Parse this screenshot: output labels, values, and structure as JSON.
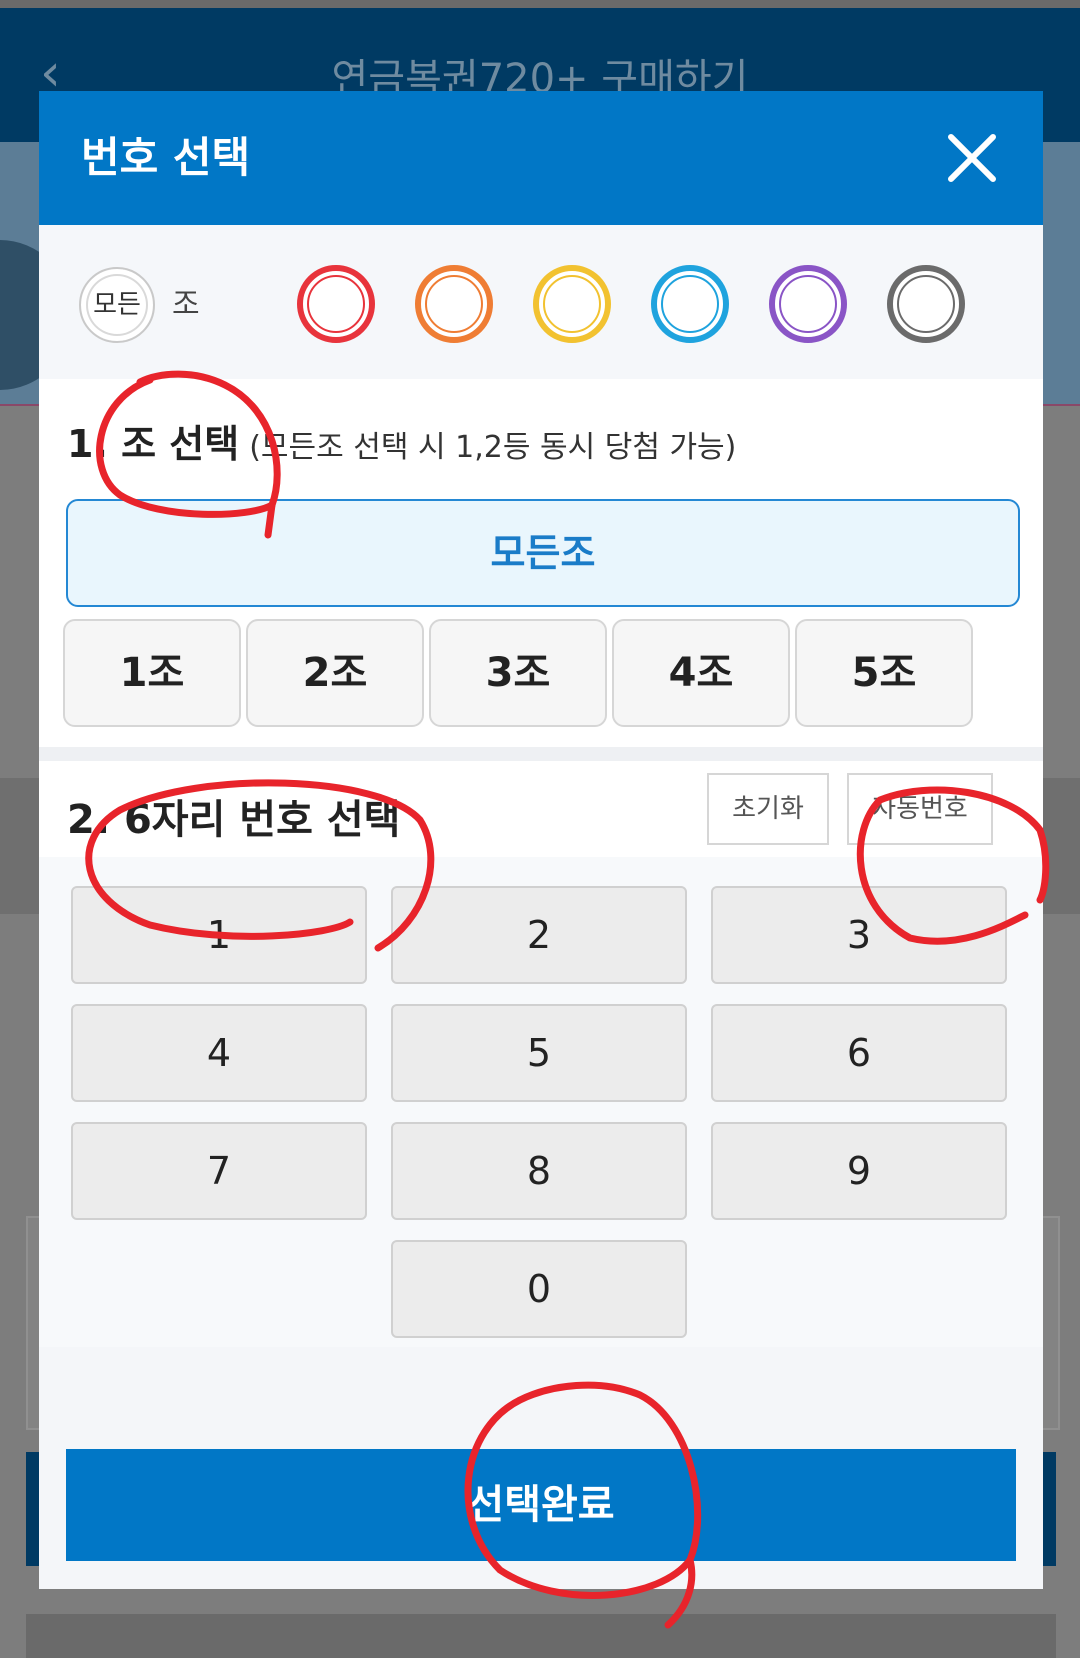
{
  "background": {
    "back_icon": "chevron-left",
    "page_title": "연금복권720+ 구매하기"
  },
  "modal": {
    "title": "번호 선택",
    "close_icon": "close-x",
    "group_selector": {
      "all_badge": "모든",
      "all_suffix": "조",
      "circle_colors": [
        "#e8343c",
        "#ef7d34",
        "#f2c230",
        "#1fa3de",
        "#8a55c6",
        "#6b6b6b"
      ]
    },
    "section1": {
      "title": "1. 조 선택",
      "subtitle": "(모든조 선택 시 1,2등 동시 당첨 가능)",
      "all_groups_button": "모든조",
      "group_buttons": [
        "1조",
        "2조",
        "3조",
        "4조",
        "5조"
      ]
    },
    "section2": {
      "title": "2. 6자리 번호 선택",
      "reset_button": "초기화",
      "auto_button": "자동번호",
      "keypad": [
        "1",
        "2",
        "3",
        "4",
        "5",
        "6",
        "7",
        "8",
        "9",
        "0"
      ]
    },
    "confirm_button": "선택완료"
  },
  "colors": {
    "header_blue": "#0177c6",
    "annotation_red": "#e8242b"
  }
}
